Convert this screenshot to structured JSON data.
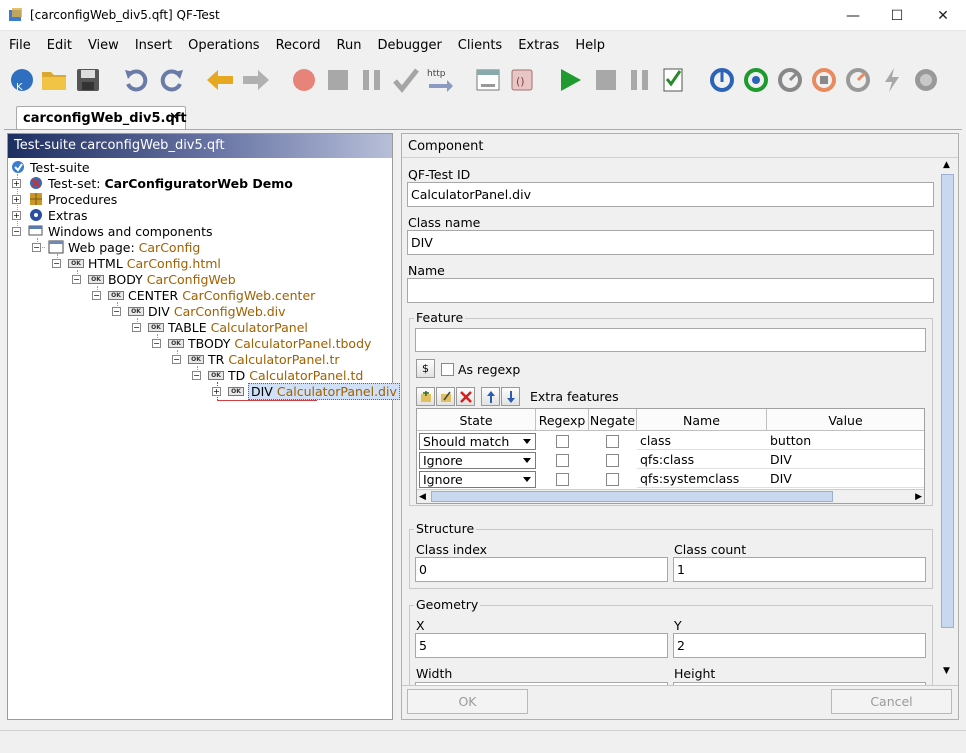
{
  "window": {
    "title": "[carconfigWeb_div5.qft] QF-Test"
  },
  "menu": [
    "File",
    "Edit",
    "View",
    "Insert",
    "Operations",
    "Record",
    "Run",
    "Debugger",
    "Clients",
    "Extras",
    "Help"
  ],
  "toolbar_icons": [
    "new-suite-icon",
    "open-icon",
    "save-icon",
    "undo-icon",
    "redo-icon",
    "back-icon",
    "forward-icon",
    "record-start-icon",
    "record-stop-icon",
    "record-pause-icon",
    "check-icon",
    "http-icon",
    "procedure-builder-icon",
    "debug-icon",
    "replay-icon",
    "stop-icon",
    "pause-icon",
    "run-log-icon",
    "step-in-icon",
    "step-over-icon",
    "step-out-icon",
    "skip-over-icon",
    "skip-out-icon",
    "jump-icon",
    "continue-icon"
  ],
  "toolbar_tooltip_http": "http",
  "tab": {
    "label": "carconfigWeb_div5.qft",
    "close": "✕"
  },
  "tree": {
    "header": "Test-suite carconfigWeb_div5.qft",
    "nodes": [
      {
        "type": "",
        "label": "Test-suite",
        "name": ""
      },
      {
        "type": "Test-set:",
        "label": "CarConfiguratorWeb Demo",
        "name": ""
      },
      {
        "type": "",
        "label": "Procedures",
        "name": ""
      },
      {
        "type": "",
        "label": "Extras",
        "name": ""
      },
      {
        "type": "",
        "label": "Windows and components",
        "name": ""
      },
      {
        "type": "Web page:",
        "label": "",
        "name": "CarConfig"
      },
      {
        "type": "HTML",
        "label": "",
        "name": "CarConfig.html"
      },
      {
        "type": "BODY",
        "label": "",
        "name": "CarConfigWeb"
      },
      {
        "type": "CENTER",
        "label": "",
        "name": "CarConfigWeb.center"
      },
      {
        "type": "DIV",
        "label": "",
        "name": "CarConfigWeb.div"
      },
      {
        "type": "TABLE",
        "label": "",
        "name": "CalculatorPanel"
      },
      {
        "type": "TBODY",
        "label": "",
        "name": "CalculatorPanel.tbody"
      },
      {
        "type": "TR",
        "label": "",
        "name": "CalculatorPanel.tr"
      },
      {
        "type": "TD",
        "label": "",
        "name": "CalculatorPanel.td"
      },
      {
        "type": "DIV",
        "label": "",
        "name": "CalculatorPanel.div"
      }
    ]
  },
  "component": {
    "header": "Component",
    "qfid_label": "QF-Test ID",
    "qfid_value": "CalculatorPanel.div",
    "class_label": "Class name",
    "class_value": "DIV",
    "name_label": "Name",
    "name_value": "",
    "feature_label": "Feature",
    "feature_value": "",
    "as_regexp": "As regexp",
    "regexp_button": "$",
    "extra_features": "Extra features",
    "table": {
      "headers": [
        "State",
        "Regexp",
        "Negate",
        "Name",
        "Value"
      ],
      "rows": [
        {
          "state": "Should match",
          "name": "class",
          "value": "button"
        },
        {
          "state": "Ignore",
          "name": "qfs:class",
          "value": "DIV"
        },
        {
          "state": "Ignore",
          "name": "qfs:systemclass",
          "value": "DIV"
        }
      ]
    },
    "structure_label": "Structure",
    "class_index_label": "Class index",
    "class_index_value": "0",
    "class_count_label": "Class count",
    "class_count_value": "1",
    "geometry_label": "Geometry",
    "x_label": "X",
    "x_value": "5",
    "y_label": "Y",
    "y_value": "2",
    "width_label": "Width",
    "height_label": "Height",
    "ok": "OK",
    "cancel": "Cancel"
  }
}
